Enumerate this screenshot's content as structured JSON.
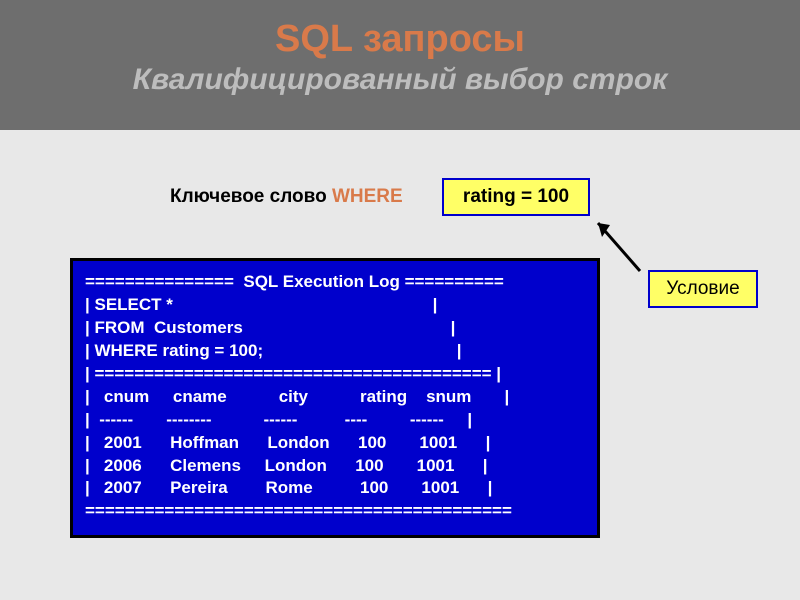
{
  "title": {
    "main": "SQL запросы",
    "sub": "Квалифицированный выбор строк"
  },
  "keyword_line": {
    "prefix": "Ключевое слово ",
    "keyword": "WHERE"
  },
  "condition_box": "rating = 100",
  "condition_label": "Условие",
  "sql_log": {
    "header": "===============  SQL Execution Log ==========",
    "q1": "| SELECT *                                                       |",
    "q2": "| FROM  Customers                                            |",
    "q3": "| WHERE rating = 100;                                         |",
    "sep_top": "| ======================================== |",
    "cols": "|   cnum     cname           city           rating    snum       |",
    "dashes": "|  ------       --------           ------          ----         ------     |",
    "r1": "|   2001      Hoffman      London      100       1001      |",
    "r2": "|   2006      Clemens     London      100       1001      |",
    "r3": "|   2007      Pereira        Rome          100       1001      |",
    "sep_bot": "==========================================="
  },
  "chart_data": {
    "type": "table",
    "title": "SQL Execution Log",
    "query": "SELECT * FROM Customers WHERE rating = 100;",
    "columns": [
      "cnum",
      "cname",
      "city",
      "rating",
      "snum"
    ],
    "rows": [
      [
        2001,
        "Hoffman",
        "London",
        100,
        1001
      ],
      [
        2006,
        "Clemens",
        "London",
        100,
        1001
      ],
      [
        2007,
        "Pereira",
        "Rome",
        100,
        1001
      ]
    ]
  }
}
